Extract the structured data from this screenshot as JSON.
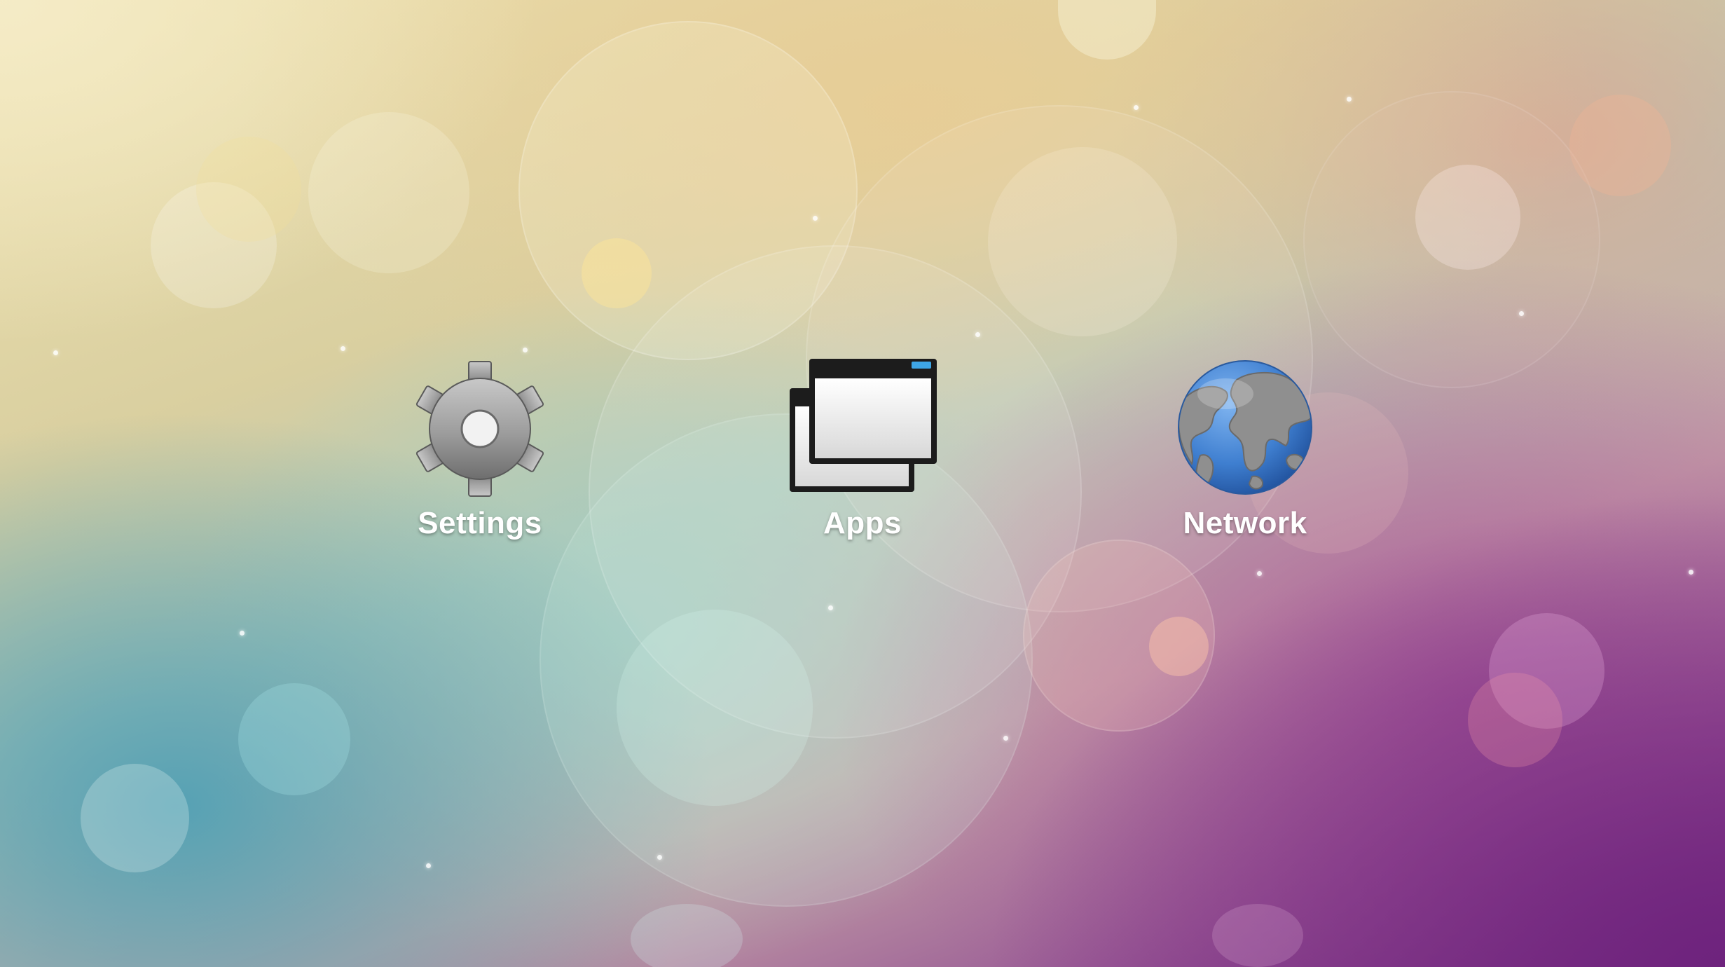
{
  "launcher": {
    "items": [
      {
        "label": "Settings",
        "icon": "gear-icon"
      },
      {
        "label": "Apps",
        "icon": "windows-icon"
      },
      {
        "label": "Network",
        "icon": "globe-icon"
      }
    ]
  },
  "colors": {
    "label_text": "#ffffff",
    "gear": "#9a9a9a",
    "window_frame": "#1c1c1c",
    "window_accent": "#3ea6e6",
    "globe_ocean": "#3f7fd0",
    "globe_land": "#8f8f8f"
  }
}
